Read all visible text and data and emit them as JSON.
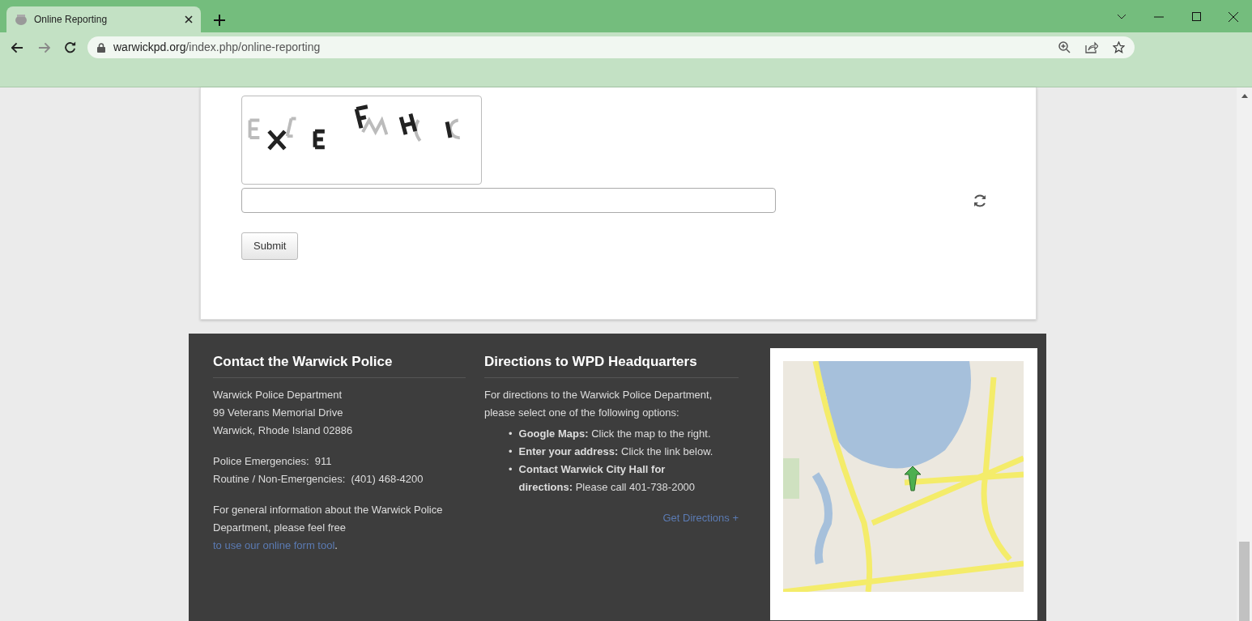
{
  "browser": {
    "tab": {
      "title": "Online Reporting"
    },
    "url": {
      "domain": "warwickpd.org",
      "path": "/index.php/online-reporting"
    }
  },
  "form": {
    "submit_label": "Submit"
  },
  "footer": {
    "contact": {
      "heading": "Contact the Warwick Police",
      "address_lines": [
        "Warwick Police Department",
        "99 Veterans Memorial Drive",
        "Warwick, Rhode Island 02886"
      ],
      "phone_lines": [
        "Police Emergencies:  911",
        "Routine / Non-Emergencies:  (401) 468-4200"
      ],
      "info": {
        "text": "For general information about the Warwick Police Department, please feel free ",
        "link": "to use our online form tool",
        "after": "."
      }
    },
    "directions": {
      "heading": "Directions to WPD Headquarters",
      "intro": "For directions to the Warwick Police Department, please select one of the following options:",
      "options": [
        {
          "marker": "•",
          "text": "**Google Maps:** Click the map to the right."
        },
        {
          "marker": "•",
          "text": "**Enter your address:** Click the link below."
        },
        {
          "marker": "•",
          "text": "**Contact Warwick City Hall for directions:** Please call 401-738-2000"
        }
      ],
      "link": "Get Directions +"
    }
  }
}
